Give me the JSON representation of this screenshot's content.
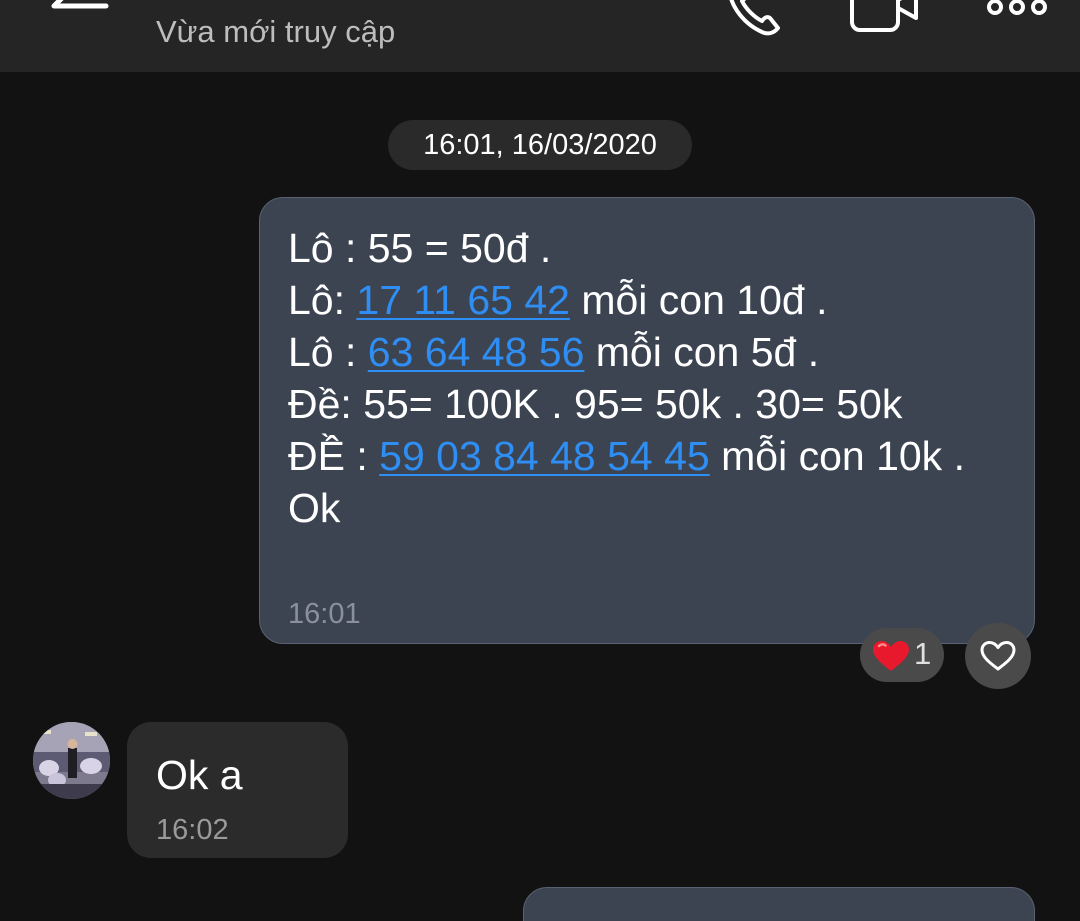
{
  "header": {
    "contact_name": "",
    "status": "Vừa mới truy cập",
    "icons": [
      "back-arrow-icon",
      "phone-icon",
      "video-call-icon",
      "more-options-icon"
    ]
  },
  "conversation": {
    "date_separator": "16:01, 16/03/2020",
    "sent_message": {
      "lines": [
        {
          "prefix": "Lô : 55 = 50đ .",
          "link": "",
          "suffix": ""
        },
        {
          "prefix": "Lô: ",
          "link": "17 11 65 42",
          "suffix": " mỗi con 10đ ."
        },
        {
          "prefix": "Lô : ",
          "link": "63 64 48 56",
          "suffix": " mỗi con 5đ ."
        },
        {
          "prefix": "Đề: 55= 100K . 95= 50k . 30= 50k",
          "link": "",
          "suffix": ""
        },
        {
          "prefix": "ĐỀ : ",
          "link": "59 03 84 48 54 45",
          "suffix": " mỗi con 10k ."
        },
        {
          "prefix": "Ok",
          "link": "",
          "suffix": ""
        }
      ],
      "time": "16:01",
      "reaction": {
        "icon": "red-heart-icon",
        "count": "1"
      },
      "like_button_icon": "heart-outline-icon"
    },
    "received_message": {
      "text": "Ok a",
      "time": "16:02"
    }
  },
  "colors": {
    "background": "#121212",
    "header_bg": "#252525",
    "sent_bubble_bg": "#3c4452",
    "received_bubble_bg": "#2b2b2b",
    "link_blue": "#2f8ef4",
    "heart_red": "#e8192c"
  }
}
